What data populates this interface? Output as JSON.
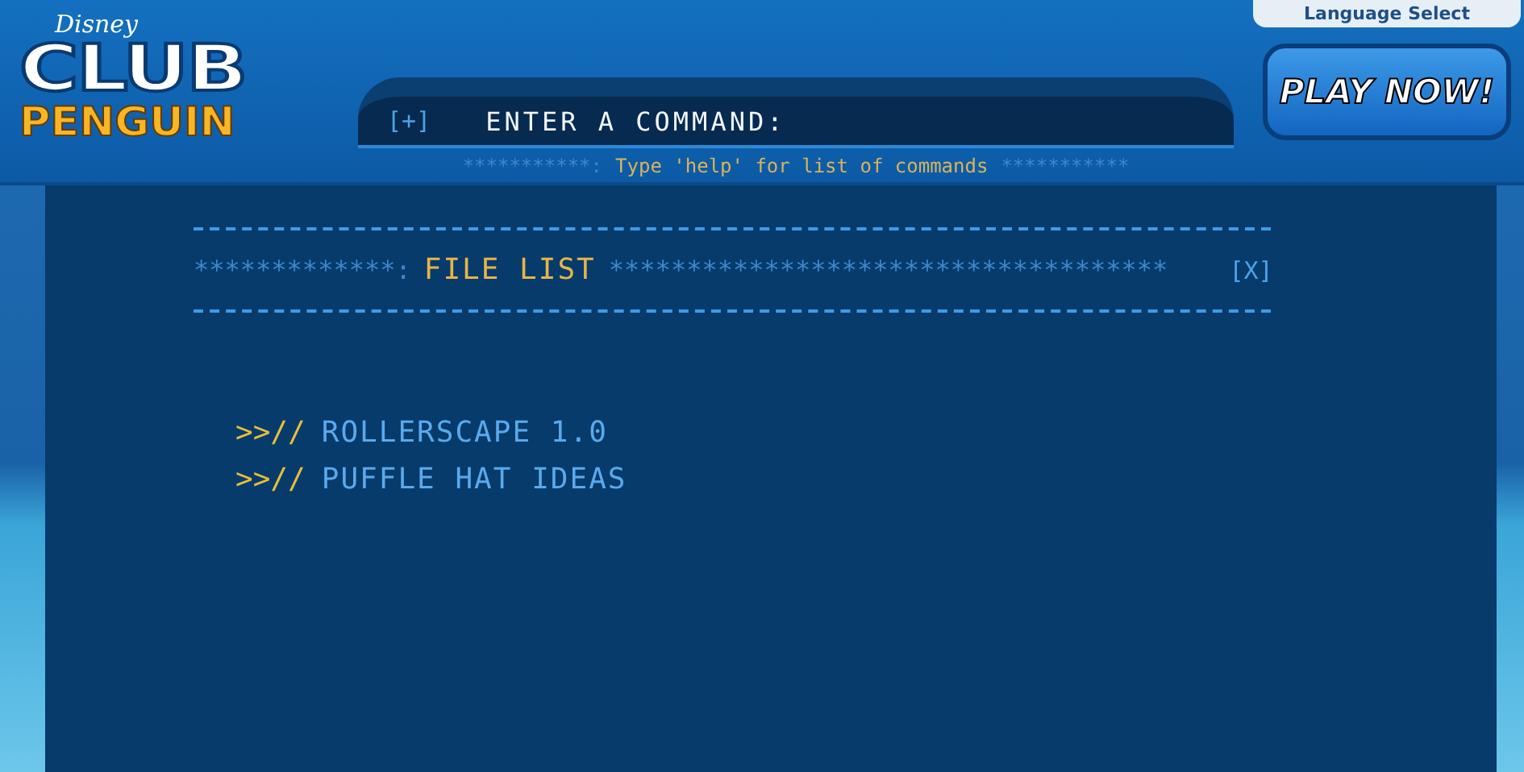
{
  "header": {
    "logo": {
      "brand": "Disney",
      "line_1": "CLUB",
      "line_2": "PENGUIN"
    },
    "language_button": "Language Select",
    "play_button": "PLAY NOW!"
  },
  "command_bar": {
    "toggle": "[+]",
    "prompt": "ENTER A COMMAND:",
    "hint_left": "***********:",
    "hint": "Type 'help' for list of commands",
    "hint_right": "***********"
  },
  "panel": {
    "stars_left": "*************:",
    "title": "FILE LIST",
    "stars_right": "************************************",
    "close": "[X]",
    "files": [
      {
        "marker": ">>//",
        "name": "ROLLERSCAPE 1.0"
      },
      {
        "marker": ">>//",
        "name": "PUFFLE HAT IDEAS"
      }
    ]
  }
}
